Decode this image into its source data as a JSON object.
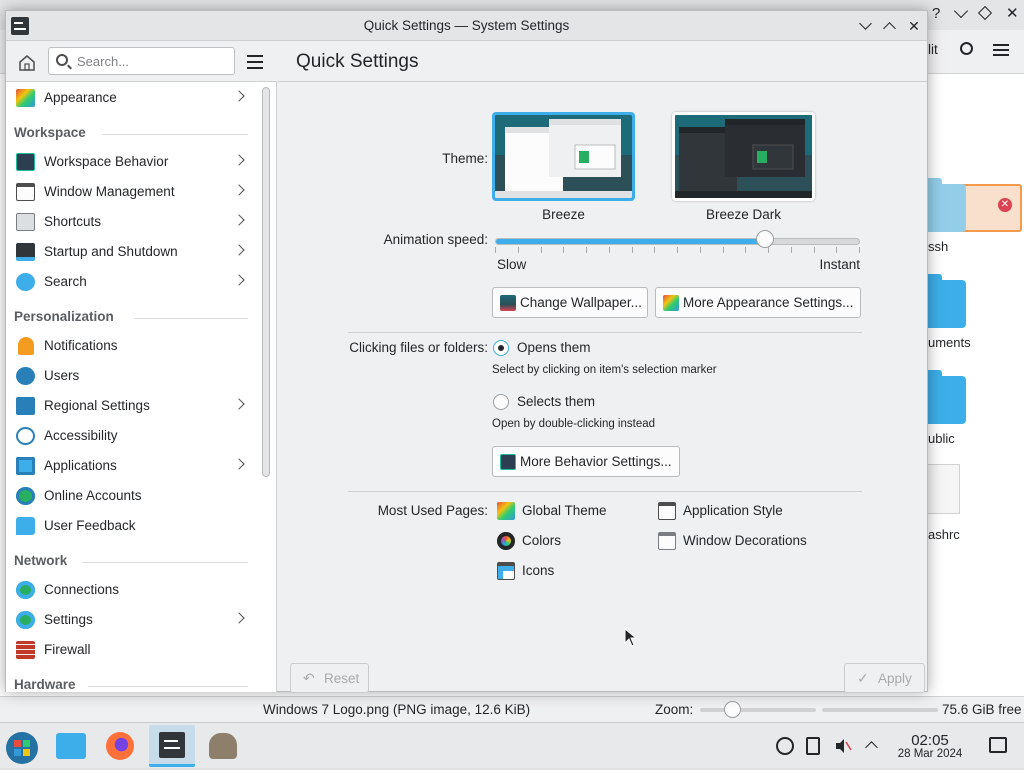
{
  "window": {
    "title": "Quick Settings — System Settings"
  },
  "background_window": {
    "toolbar_text": "lit",
    "folders": [
      "ssh",
      "uments",
      "ublic"
    ],
    "file_label": "ashrc",
    "status_file": "Windows 7 Logo.png (PNG image, 12.6 KiB)",
    "zoom_label": "Zoom:",
    "free_space": "75.6 GiB free"
  },
  "sidebar": {
    "search_placeholder": "Search...",
    "items": [
      {
        "label": "Appearance",
        "icon": "appearance-icon",
        "has_children": true
      },
      {
        "label": "Workspace",
        "section": true
      },
      {
        "label": "Workspace Behavior",
        "icon": "workspace-behavior-icon",
        "has_children": true
      },
      {
        "label": "Window Management",
        "icon": "window-management-icon",
        "has_children": true
      },
      {
        "label": "Shortcuts",
        "icon": "keyboard-icon",
        "has_children": true
      },
      {
        "label": "Startup and Shutdown",
        "icon": "startup-icon",
        "has_children": true
      },
      {
        "label": "Search",
        "icon": "search-globe-icon",
        "has_children": true
      },
      {
        "label": "Personalization",
        "section": true
      },
      {
        "label": "Notifications",
        "icon": "bell-icon",
        "has_children": false
      },
      {
        "label": "Users",
        "icon": "users-icon",
        "has_children": false
      },
      {
        "label": "Regional Settings",
        "icon": "regional-flag-icon",
        "has_children": true
      },
      {
        "label": "Accessibility",
        "icon": "accessibility-icon",
        "has_children": false
      },
      {
        "label": "Applications",
        "icon": "applications-grid-icon",
        "has_children": true
      },
      {
        "label": "Online Accounts",
        "icon": "online-accounts-icon",
        "has_children": false
      },
      {
        "label": "User Feedback",
        "icon": "feedback-bubble-icon",
        "has_children": false
      },
      {
        "label": "Network",
        "section": true
      },
      {
        "label": "Connections",
        "icon": "globe-icon",
        "has_children": false
      },
      {
        "label": "Settings",
        "icon": "globe-settings-icon",
        "has_children": true
      },
      {
        "label": "Firewall",
        "icon": "firewall-brick-icon",
        "has_children": false
      },
      {
        "label": "Hardware",
        "section": true
      }
    ]
  },
  "content": {
    "title": "Quick Settings",
    "theme_label": "Theme:",
    "themes": [
      {
        "name": "Breeze",
        "selected": true
      },
      {
        "name": "Breeze Dark",
        "selected": false
      }
    ],
    "animation_label": "Animation speed:",
    "animation_min": "Slow",
    "animation_max": "Instant",
    "animation_value": 0.74,
    "change_wallpaper": "Change Wallpaper...",
    "more_appearance": "More Appearance Settings...",
    "clicking_label": "Clicking files or folders:",
    "option_open": "Opens them",
    "option_open_hint": "Select by clicking on item's selection marker",
    "option_select": "Selects them",
    "option_select_hint": "Open by double-clicking instead",
    "selected_option": "open",
    "more_behavior": "More Behavior Settings...",
    "most_used_label": "Most Used Pages:",
    "most_used": [
      {
        "label": "Global Theme",
        "icon": "global-theme-icon"
      },
      {
        "label": "Application Style",
        "icon": "application-style-icon"
      },
      {
        "label": "Colors",
        "icon": "colors-icon"
      },
      {
        "label": "Window Decorations",
        "icon": "window-decorations-icon"
      },
      {
        "label": "Icons",
        "icon": "icons-icon"
      }
    ],
    "reset": "Reset",
    "apply": "Apply"
  },
  "taskbar": {
    "time": "02:05",
    "date": "28 Mar 2024"
  },
  "colors": {
    "accent": "#3daee9",
    "window_bg": "#eff0f1",
    "text": "#232629"
  }
}
